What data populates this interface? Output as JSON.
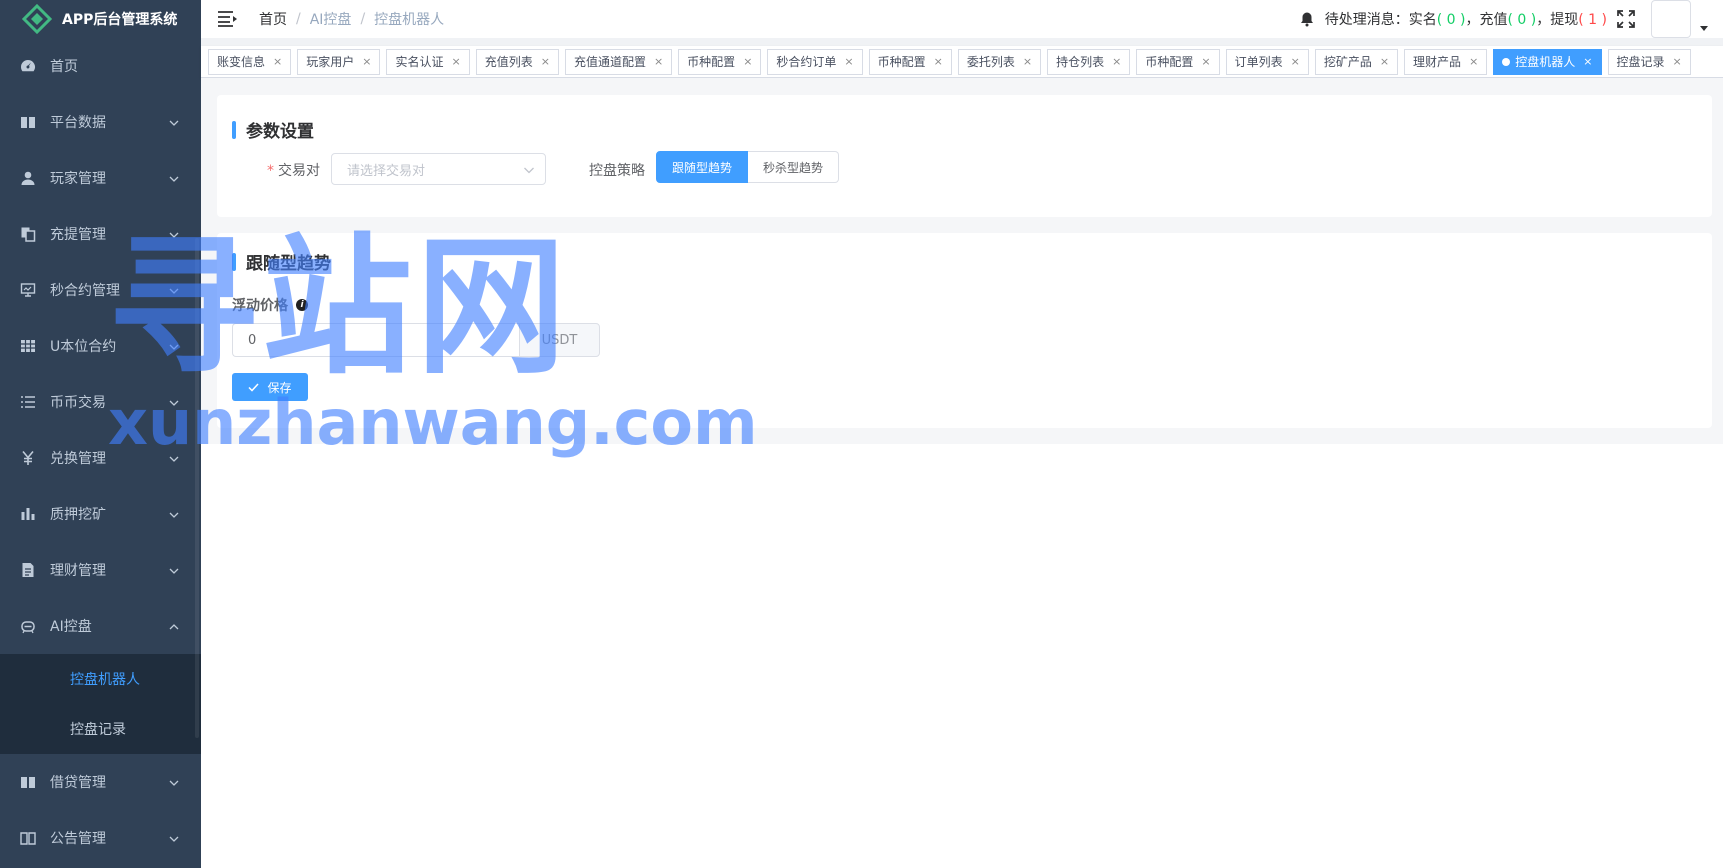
{
  "app": {
    "title": "APP后台管理系统"
  },
  "sidebar": {
    "items": [
      {
        "label": "首页",
        "icon": "dashboard-icon",
        "expandable": false
      },
      {
        "label": "平台数据",
        "icon": "book-icon",
        "expandable": true
      },
      {
        "label": "玩家管理",
        "icon": "user-icon",
        "expandable": true
      },
      {
        "label": "充提管理",
        "icon": "copy-icon",
        "expandable": true
      },
      {
        "label": "秒合约管理",
        "icon": "monitor-icon",
        "expandable": true
      },
      {
        "label": "U本位合约",
        "icon": "table-icon",
        "expandable": true
      },
      {
        "label": "币币交易",
        "icon": "list-icon",
        "expandable": true
      },
      {
        "label": "兑换管理",
        "icon": "yen-icon",
        "expandable": true
      },
      {
        "label": "质押挖矿",
        "icon": "bar-chart-icon",
        "expandable": true
      },
      {
        "label": "理财管理",
        "icon": "document-icon",
        "expandable": true
      },
      {
        "label": "AI控盘",
        "icon": "robot-icon",
        "expandable": true,
        "open": true
      }
    ],
    "submenu": [
      {
        "label": "控盘机器人",
        "active": true
      },
      {
        "label": "控盘记录",
        "active": false
      }
    ],
    "items_after": [
      {
        "label": "借贷管理",
        "icon": "book-icon",
        "expandable": true
      },
      {
        "label": "公告管理",
        "icon": "book-open-icon",
        "expandable": true
      }
    ]
  },
  "navbar": {
    "breadcrumb": [
      "首页",
      "AI控盘",
      "控盘机器人"
    ],
    "message_prefix": "待处理消息：",
    "realname_label": "实名",
    "realname_count": "0",
    "recharge_label": "充值",
    "recharge_count": "0",
    "withdraw_label": "提现",
    "withdraw_count": "1"
  },
  "tags": [
    {
      "label": "账变信息",
      "active": false
    },
    {
      "label": "玩家用户",
      "active": false
    },
    {
      "label": "实名认证",
      "active": false
    },
    {
      "label": "充值列表",
      "active": false
    },
    {
      "label": "充值通道配置",
      "active": false
    },
    {
      "label": "币种配置",
      "active": false
    },
    {
      "label": "秒合约订单",
      "active": false
    },
    {
      "label": "币种配置",
      "active": false
    },
    {
      "label": "委托列表",
      "active": false
    },
    {
      "label": "持仓列表",
      "active": false
    },
    {
      "label": "币种配置",
      "active": false
    },
    {
      "label": "订单列表",
      "active": false
    },
    {
      "label": "挖矿产品",
      "active": false
    },
    {
      "label": "理财产品",
      "active": false
    },
    {
      "label": "控盘机器人",
      "active": true
    },
    {
      "label": "控盘记录",
      "active": false
    }
  ],
  "params_card": {
    "title": "参数设置",
    "pair_label": "交易对",
    "pair_placeholder": "请选择交易对",
    "strategy_label": "控盘策略",
    "strategies": [
      "跟随型趋势",
      "秒杀型趋势"
    ],
    "active_strategy": "跟随型趋势"
  },
  "trend_card": {
    "title": "跟随型趋势",
    "float_label": "浮动价格",
    "float_value": "0",
    "unit": "USDT",
    "save_label": "保存"
  },
  "watermark": {
    "cn": "寻站网",
    "en": "xunzhanwang.com"
  },
  "colors": {
    "sidebar_bg": "#304156",
    "submenu_bg": "#1f2d3d",
    "primary": "#409eff",
    "success": "#13ce66",
    "danger": "#ff4949"
  }
}
